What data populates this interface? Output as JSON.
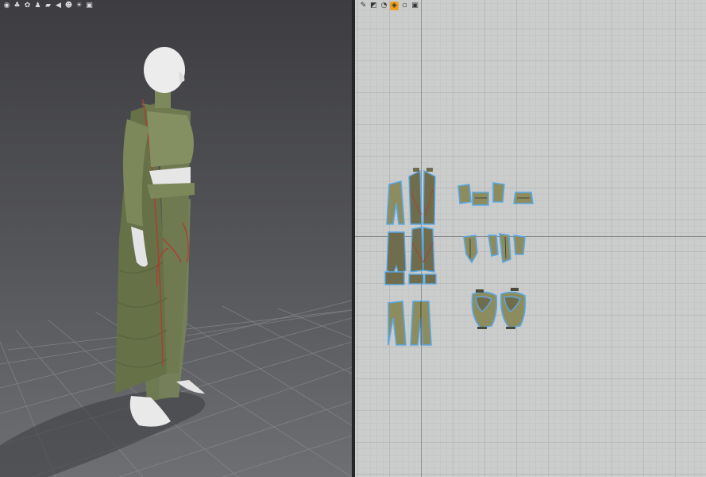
{
  "window": {
    "panels": [
      "3D Garment Window",
      "2D Pattern Window"
    ]
  },
  "toolbar_3d": {
    "icons": [
      "avatar-display-icon",
      "garment-display-icon",
      "texture-display-icon",
      "avatar-pose-icon",
      "fabric-icon",
      "measure-icon",
      "avatar-icon",
      "sun-light-icon",
      "camera-icon"
    ]
  },
  "toolbar_2d": {
    "icons": [
      "pattern-tool-icon",
      "edit-point-icon",
      "segment-icon",
      "texture-2d-icon",
      "fold-icon",
      "camera-2d-icon"
    ]
  },
  "colors": {
    "fabric": "#6e7a52",
    "fabric_light": "#8a9466",
    "pattern_fill": "#8d8c5e",
    "pattern_outline": "#5aa8e6",
    "seam_red": "#b33a2c",
    "selected_tool": "#f0a020",
    "grid_bg": "#cbcccc",
    "viewport_bg": "#55565a"
  },
  "pattern_groups": [
    "coat-front-back-pieces",
    "top-bodice-pieces",
    "coat-sleeve-pieces",
    "bodice-side-pieces",
    "pants-pieces",
    "padded-pocket-pieces"
  ]
}
